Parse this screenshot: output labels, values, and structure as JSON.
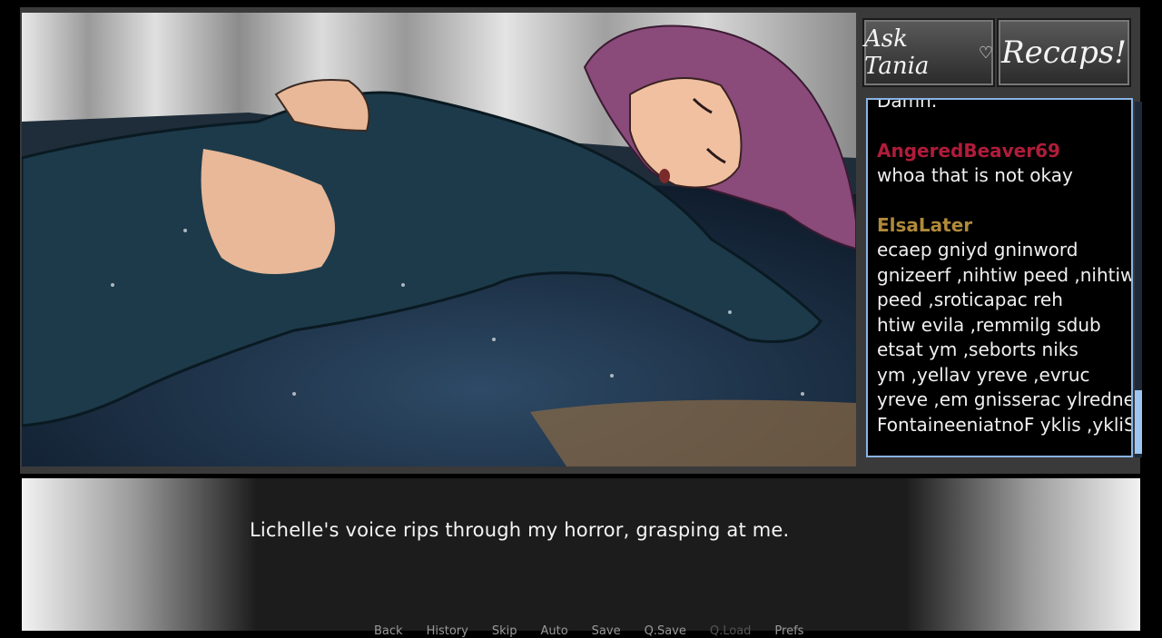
{
  "side_buttons": {
    "ask_label": "Ask Tania",
    "ask_heart": "♡",
    "recaps_label": "Recaps!"
  },
  "chat": {
    "top_partial": "Damn.",
    "messages": [
      {
        "user": "AngeredBeaver69",
        "color": "#b01c3a",
        "lines": [
          "whoa that is not okay"
        ]
      },
      {
        "user": "ElsaLater",
        "color": "#b08a3a",
        "lines": [
          "ecaep gniyd gninword",
          "gnizeerf ,nihtiw peed ,nihtiw",
          "peed ,sroticapac reh",
          "htiw evila ,remmilg sdub",
          "etsat ym ,seborts niks",
          "ym ,yellav yreve ,evruc",
          "yreve ,em gnisserac ylrednet",
          "FontaineeniatnoF yklis ,ykliS"
        ]
      }
    ]
  },
  "dialogue": {
    "text": "Lichelle's voice rips through my horror, grasping at me."
  },
  "quick_menu": {
    "back": "Back",
    "history": "History",
    "skip": "Skip",
    "auto": "Auto",
    "save": "Save",
    "qsave": "Q.Save",
    "qload": "Q.Load",
    "prefs": "Prefs"
  }
}
